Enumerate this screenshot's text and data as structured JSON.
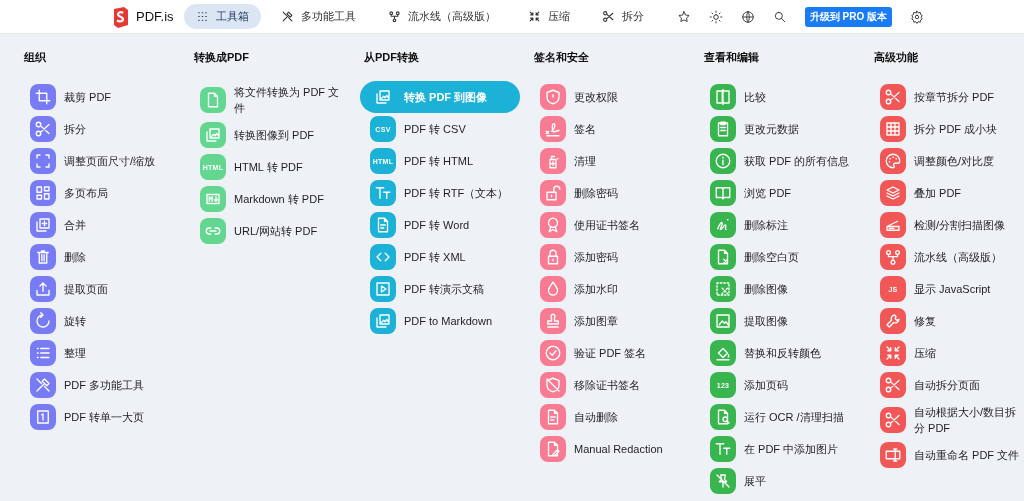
{
  "header": {
    "logo": "PDF.is",
    "nav": [
      {
        "label": "工具箱",
        "selected": true
      },
      {
        "label": "多功能工具",
        "selected": false
      },
      {
        "label": "流水线（高级版）",
        "selected": false
      },
      {
        "label": "压缩",
        "selected": false
      },
      {
        "label": "拆分",
        "selected": false
      }
    ],
    "upgrade_button": "升级到 PRO 版本"
  },
  "groups": [
    {
      "title": "组织",
      "color": "#777cf4",
      "items": [
        {
          "label": "裁剪 PDF",
          "selected": false
        },
        {
          "label": "拆分",
          "selected": false
        },
        {
          "label": "调整页面尺寸/缩放",
          "selected": false
        },
        {
          "label": "多页布局",
          "selected": false
        },
        {
          "label": "合并",
          "selected": false
        },
        {
          "label": "删除",
          "selected": false
        },
        {
          "label": "提取页面",
          "selected": false
        },
        {
          "label": "旋转",
          "selected": false
        },
        {
          "label": "整理",
          "selected": false
        },
        {
          "label": "PDF 多功能工具",
          "selected": false
        },
        {
          "label": "PDF 转单一大页",
          "selected": false
        }
      ]
    },
    {
      "title": "转换成PDF",
      "color": "#63d78f",
      "items": [
        {
          "label": "将文件转换为 PDF 文件",
          "selected": false
        },
        {
          "label": "转换图像到 PDF",
          "selected": false
        },
        {
          "label": "HTML 转 PDF",
          "selected": false,
          "icon_text": "HTML"
        },
        {
          "label": "Markdown 转 PDF",
          "selected": false
        },
        {
          "label": "URL/网站转 PDF",
          "selected": false
        }
      ]
    },
    {
      "title": "从PDF转换",
      "color": "#1cb2d7",
      "items": [
        {
          "label": "转换 PDF 到图像",
          "selected": true
        },
        {
          "label": "PDF 转 CSV",
          "selected": false,
          "icon_text": "CSV"
        },
        {
          "label": "PDF 转 HTML",
          "selected": false,
          "icon_text": "HTML"
        },
        {
          "label": "PDF 转 RTF（文本）",
          "selected": false
        },
        {
          "label": "PDF 转 Word",
          "selected": false
        },
        {
          "label": "PDF 转 XML",
          "selected": false
        },
        {
          "label": "PDF 转演示文稿",
          "selected": false
        },
        {
          "label": "PDF to Markdown",
          "selected": false
        }
      ]
    },
    {
      "title": "签名和安全",
      "color": "#f77b91",
      "items": [
        {
          "label": "更改权限",
          "selected": false
        },
        {
          "label": "签名",
          "selected": false
        },
        {
          "label": "清理",
          "selected": false
        },
        {
          "label": "删除密码",
          "selected": false
        },
        {
          "label": "使用证书签名",
          "selected": false
        },
        {
          "label": "添加密码",
          "selected": false
        },
        {
          "label": "添加水印",
          "selected": false
        },
        {
          "label": "添加图章",
          "selected": false
        },
        {
          "label": "验证 PDF 签名",
          "selected": false
        },
        {
          "label": "移除证书签名",
          "selected": false
        },
        {
          "label": "自动删除",
          "selected": false
        },
        {
          "label": "Manual Redaction",
          "selected": false
        }
      ]
    },
    {
      "title": "查看和编辑",
      "color": "#39b54f",
      "items": [
        {
          "label": "比较",
          "selected": false
        },
        {
          "label": "更改元数据",
          "selected": false
        },
        {
          "label": "获取 PDF 的所有信息",
          "selected": false
        },
        {
          "label": "浏览 PDF",
          "selected": false
        },
        {
          "label": "删除标注",
          "selected": false
        },
        {
          "label": "删除空白页",
          "selected": false
        },
        {
          "label": "删除图像",
          "selected": false
        },
        {
          "label": "提取图像",
          "selected": false
        },
        {
          "label": "替换和反转颜色",
          "selected": false
        },
        {
          "label": "添加页码",
          "selected": false,
          "icon_text": "123"
        },
        {
          "label": "运行 OCR /清理扫描",
          "selected": false
        },
        {
          "label": "在 PDF 中添加图片",
          "selected": false
        },
        {
          "label": "展平",
          "selected": false
        }
      ]
    },
    {
      "title": "高级功能",
      "color": "#f25757",
      "items": [
        {
          "label": "按章节拆分 PDF",
          "selected": false
        },
        {
          "label": "拆分 PDF 成小块",
          "selected": false
        },
        {
          "label": "调整颜色/对比度",
          "selected": false
        },
        {
          "label": "叠加 PDF",
          "selected": false
        },
        {
          "label": "检测/分割扫描图像",
          "selected": false
        },
        {
          "label": "流水线（高级版）",
          "selected": false
        },
        {
          "label": "显示 JavaScript",
          "selected": false,
          "icon_text": "JS"
        },
        {
          "label": "修复",
          "selected": false
        },
        {
          "label": "压缩",
          "selected": false
        },
        {
          "label": "自动拆分页面",
          "selected": false
        },
        {
          "label": "自动根据大小/数目拆分 PDF",
          "selected": false
        },
        {
          "label": "自动重命名 PDF 文件",
          "selected": false
        }
      ]
    }
  ]
}
